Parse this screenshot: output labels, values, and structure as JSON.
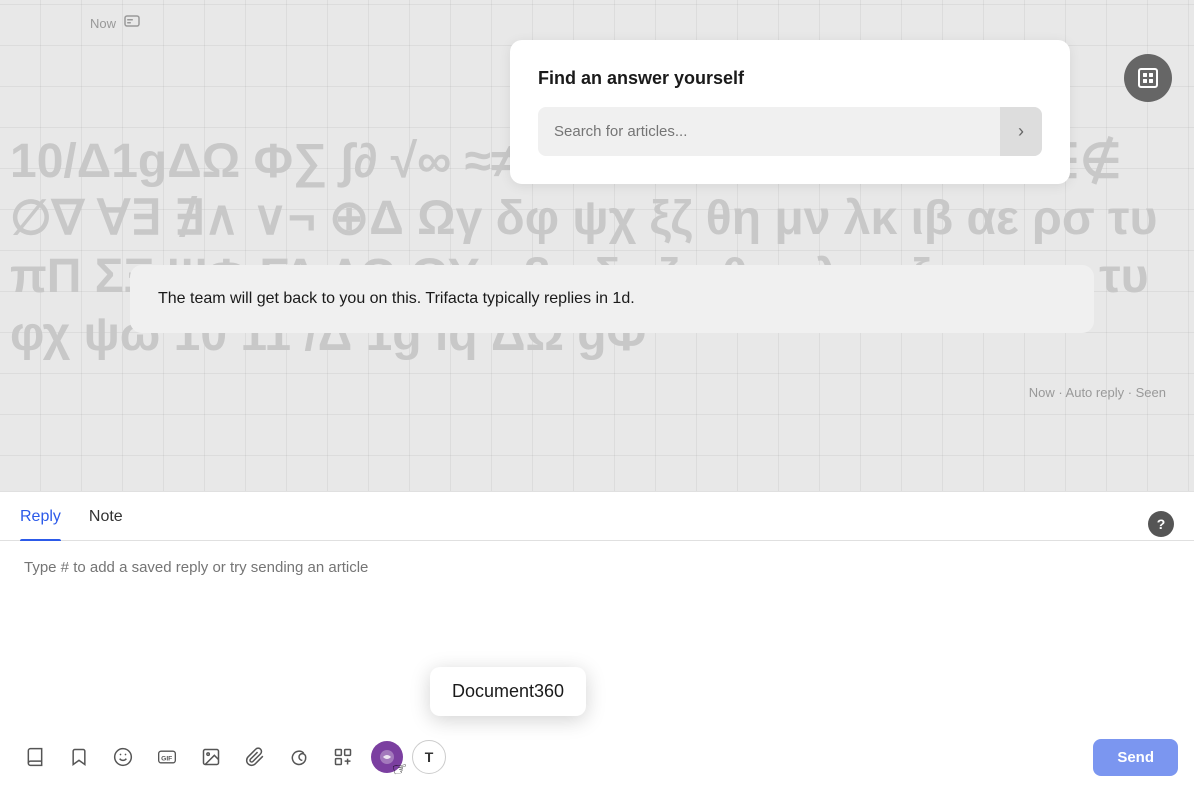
{
  "background": {
    "symbols": "ΔΩΦ∑∏∫∂√∞≈≠≤≥→←↑↓⊕⊗⊂⊃∪∩∈∉∅∇∀∃∄∧∨¬⊕"
  },
  "timestamp": {
    "label": "Now",
    "icon": "message-icon"
  },
  "find_answer": {
    "title": "Find an answer yourself",
    "search_placeholder": "Search for articles...",
    "search_btn_label": "›"
  },
  "auto_reply": {
    "message": "The team will get back to you on this. Trifacta typically replies in 1d.",
    "meta": "Now · Auto reply · Seen"
  },
  "reply_panel": {
    "tab_reply": "Reply",
    "tab_note": "Note",
    "help_label": "?",
    "textarea_placeholder": "Type # to add a saved reply or try sending an article",
    "send_label": "Send"
  },
  "toolbar": {
    "book_icon": "book",
    "bookmark_icon": "bookmark",
    "emoji_icon": "emoji",
    "gif_icon": "GIF",
    "image_icon": "image",
    "attach_icon": "attach",
    "mention_icon": "mention",
    "apps_icon": "apps",
    "plugin_icon": "plugin",
    "t_icon": "T"
  },
  "tooltip": {
    "label": "Document360"
  },
  "colors": {
    "active_tab": "#2c5ae9",
    "send_btn": "#7b96f0",
    "purple_icon": "#7b3fa0"
  }
}
